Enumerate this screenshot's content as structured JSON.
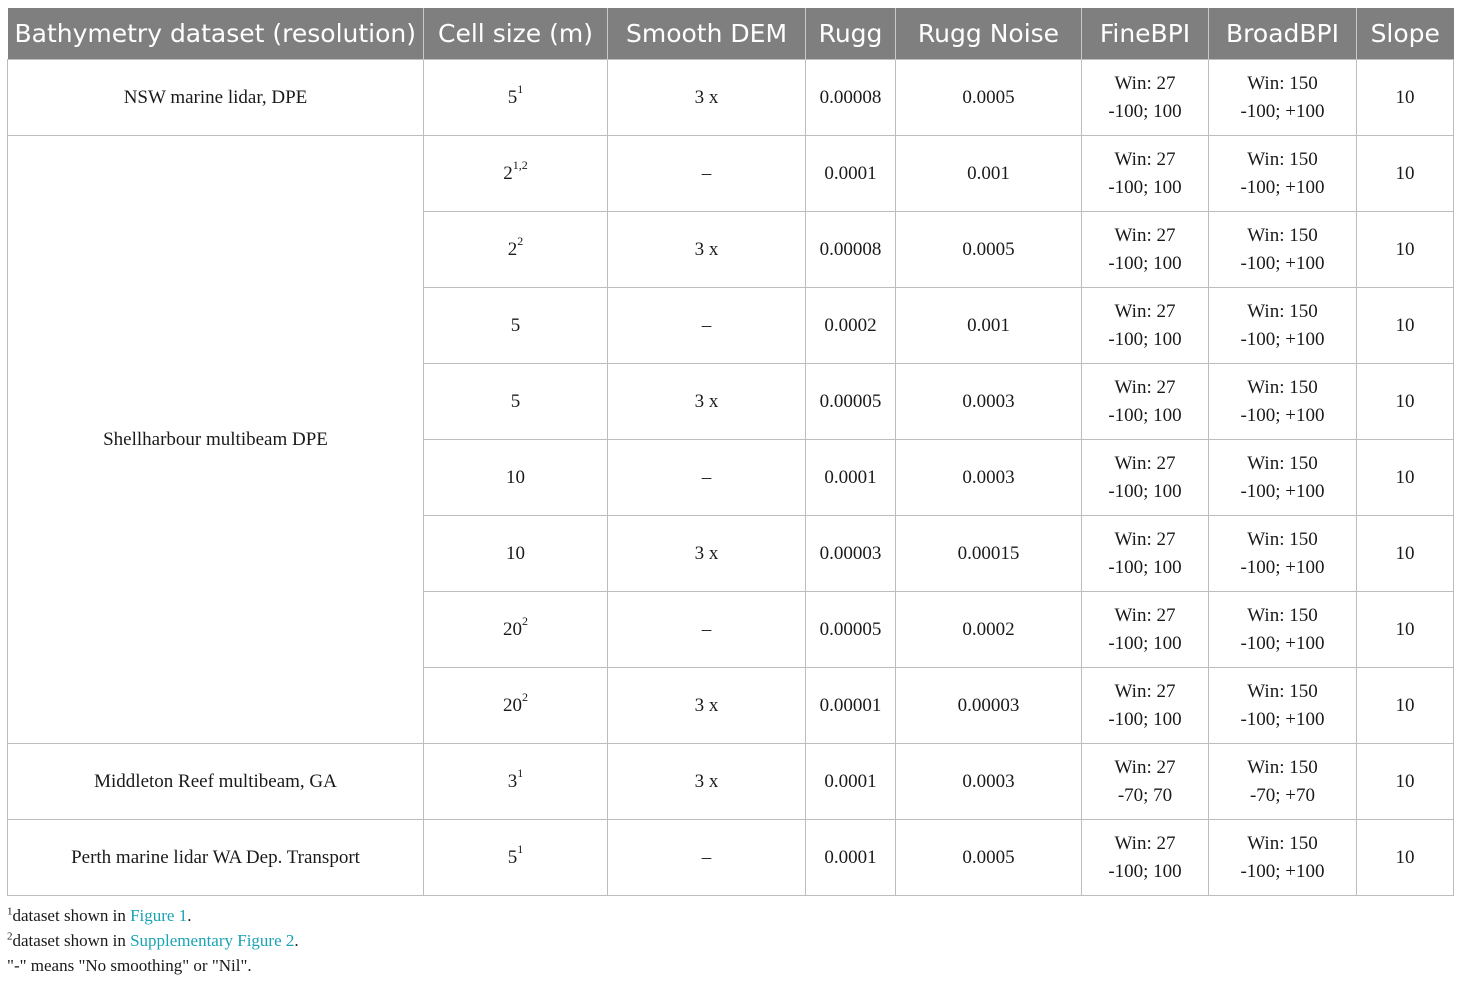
{
  "table": {
    "headers": [
      "Bathymetry dataset (resolution)",
      "Cell size (m)",
      "Smooth DEM",
      "Rugg",
      "Rugg Noise",
      "FineBPI",
      "BroadBPI",
      "Slope"
    ],
    "groups": [
      {
        "dataset": "NSW marine lidar, DPE",
        "rows": [
          {
            "cell": "5",
            "sup": "1",
            "smooth": "3 x",
            "rugg": "0.00008",
            "noise": "0.0005",
            "fine": [
              "Win: 27",
              "-100; 100"
            ],
            "broad": [
              "Win: 150",
              "-100; +100"
            ],
            "slope": "10"
          }
        ]
      },
      {
        "dataset": "Shellharbour multibeam DPE",
        "rows": [
          {
            "cell": "2",
            "sup": "1,2",
            "smooth": "–",
            "rugg": "0.0001",
            "noise": "0.001",
            "fine": [
              "Win: 27",
              "-100; 100"
            ],
            "broad": [
              "Win: 150",
              "-100; +100"
            ],
            "slope": "10"
          },
          {
            "cell": "2",
            "sup": "2",
            "smooth": "3 x",
            "rugg": "0.00008",
            "noise": "0.0005",
            "fine": [
              "Win: 27",
              "-100; 100"
            ],
            "broad": [
              "Win: 150",
              "-100; +100"
            ],
            "slope": "10"
          },
          {
            "cell": "5",
            "sup": "",
            "smooth": "–",
            "rugg": "0.0002",
            "noise": "0.001",
            "fine": [
              "Win: 27",
              "-100; 100"
            ],
            "broad": [
              "Win: 150",
              "-100; +100"
            ],
            "slope": "10"
          },
          {
            "cell": "5",
            "sup": "",
            "smooth": "3 x",
            "rugg": "0.00005",
            "noise": "0.0003",
            "fine": [
              "Win: 27",
              "-100; 100"
            ],
            "broad": [
              "Win: 150",
              "-100; +100"
            ],
            "slope": "10"
          },
          {
            "cell": "10",
            "sup": "",
            "smooth": "–",
            "rugg": "0.0001",
            "noise": "0.0003",
            "fine": [
              "Win: 27",
              "-100; 100"
            ],
            "broad": [
              "Win: 150",
              "-100; +100"
            ],
            "slope": "10"
          },
          {
            "cell": "10",
            "sup": "",
            "smooth": "3 x",
            "rugg": "0.00003",
            "noise": "0.00015",
            "fine": [
              "Win: 27",
              "-100; 100"
            ],
            "broad": [
              "Win: 150",
              "-100; +100"
            ],
            "slope": "10"
          },
          {
            "cell": "20",
            "sup": "2",
            "smooth": "–",
            "rugg": "0.00005",
            "noise": "0.0002",
            "fine": [
              "Win: 27",
              "-100; 100"
            ],
            "broad": [
              "Win: 150",
              "-100; +100"
            ],
            "slope": "10"
          },
          {
            "cell": "20",
            "sup": "2",
            "smooth": "3 x",
            "rugg": "0.00001",
            "noise": "0.00003",
            "fine": [
              "Win: 27",
              "-100; 100"
            ],
            "broad": [
              "Win: 150",
              "-100; +100"
            ],
            "slope": "10"
          }
        ]
      },
      {
        "dataset": "Middleton Reef multibeam, GA",
        "rows": [
          {
            "cell": "3",
            "sup": "1",
            "smooth": "3 x",
            "rugg": "0.0001",
            "noise": "0.0003",
            "fine": [
              "Win: 27",
              "-70; 70"
            ],
            "broad": [
              "Win: 150",
              "-70; +70"
            ],
            "slope": "10"
          }
        ]
      },
      {
        "dataset": "Perth marine lidar WA Dep. Transport",
        "rows": [
          {
            "cell": "5",
            "sup": "1",
            "smooth": "–",
            "rugg": "0.0001",
            "noise": "0.0005",
            "fine": [
              "Win: 27",
              "-100; 100"
            ],
            "broad": [
              "Win: 150",
              "-100; +100"
            ],
            "slope": "10"
          }
        ]
      }
    ]
  },
  "footnotes": {
    "note1": {
      "mark": "1",
      "text": "dataset shown in ",
      "link": "Figure 1",
      "end": "."
    },
    "note2": {
      "mark": "2",
      "text": "dataset shown in ",
      "link": "Supplementary Figure 2",
      "end": "."
    },
    "note3": {
      "text": "\"-\" means \"No smoothing\" or \"Nil\"."
    }
  },
  "colors": {
    "header_bg": "#7f7f7f",
    "link": "#1aa3b3"
  }
}
